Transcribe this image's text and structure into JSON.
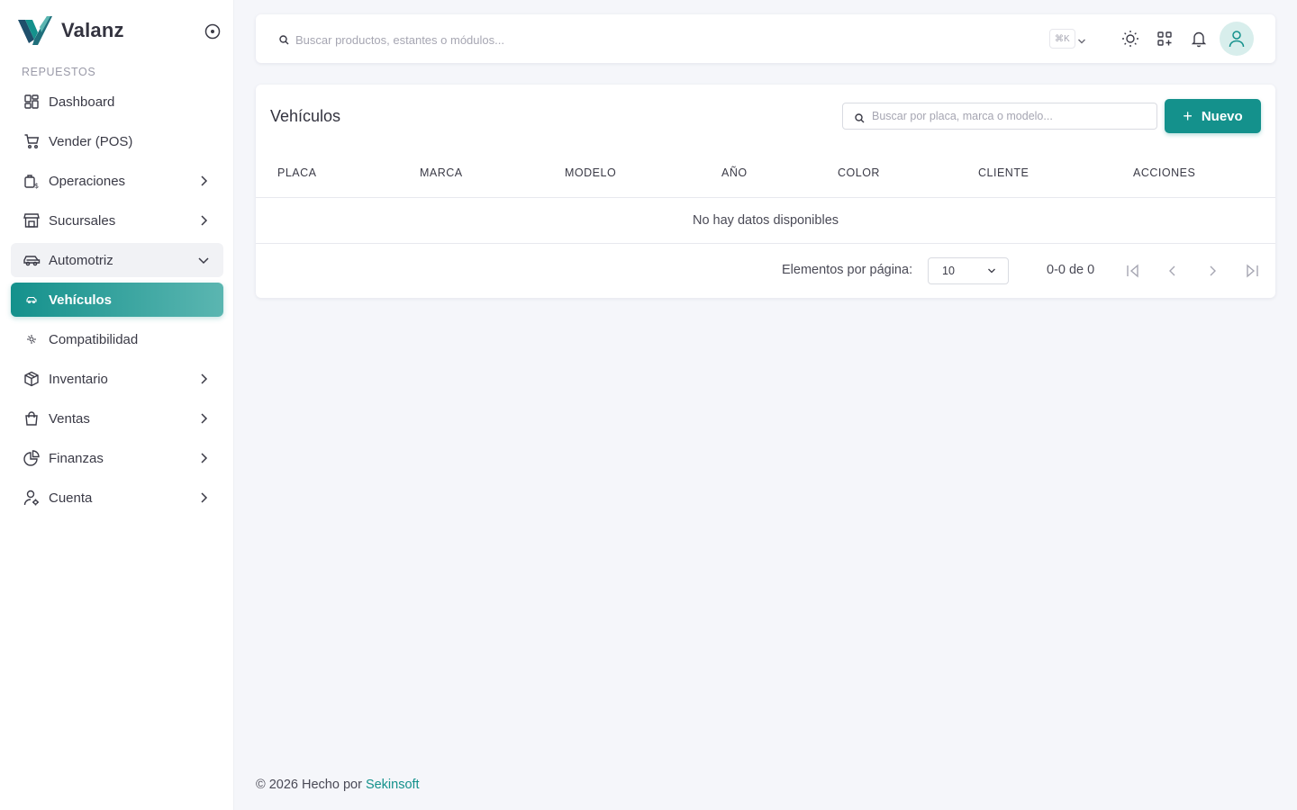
{
  "colors": {
    "accent": "#14918c",
    "accent_light": "#5bb6b1",
    "avatar_bg": "#d8eeec",
    "background": "#f5f6fa"
  },
  "brand": {
    "name": "Valanz",
    "logo_icon": "valanz-logo"
  },
  "sidebar": {
    "section_title": "REPUESTOS",
    "items": [
      {
        "label": "Dashboard",
        "icon": "dashboard-icon",
        "expandable": false
      },
      {
        "label": "Vender (POS)",
        "icon": "cart-icon",
        "expandable": false
      },
      {
        "label": "Operaciones",
        "icon": "operations-icon",
        "expandable": true
      },
      {
        "label": "Sucursales",
        "icon": "store-icon",
        "expandable": true
      },
      {
        "label": "Automotriz",
        "icon": "car-icon",
        "expandable": true,
        "expanded": true
      },
      {
        "label": "Vehículos",
        "icon": "vehicle-icon",
        "active": true
      },
      {
        "label": "Compatibilidad",
        "icon": "compatibility-icon"
      },
      {
        "label": "Inventario",
        "icon": "box-icon",
        "expandable": true
      },
      {
        "label": "Ventas",
        "icon": "bag-icon",
        "expandable": true
      },
      {
        "label": "Finanzas",
        "icon": "pie-chart-icon",
        "expandable": true
      },
      {
        "label": "Cuenta",
        "icon": "user-settings-icon",
        "expandable": true
      }
    ]
  },
  "topbar": {
    "search_placeholder": "Buscar productos, estantes o módulos...",
    "shortcut": "⌘K",
    "icons": [
      "sun-icon",
      "apps-icon",
      "bell-icon",
      "user-icon"
    ]
  },
  "page": {
    "title": "Vehículos",
    "search_placeholder": "Buscar por placa, marca o modelo...",
    "new_button": "Nuevo",
    "columns": [
      "PLACA",
      "MARCA",
      "MODELO",
      "AÑO",
      "COLOR",
      "CLIENTE",
      "ACCIONES"
    ],
    "rows": [],
    "empty_message": "No hay datos disponibles",
    "pagination": {
      "items_per_page_label": "Elementos por página:",
      "items_per_page": "10",
      "range": "0-0 de 0"
    }
  },
  "footer": {
    "text": "© 2026 Hecho por",
    "link": "Sekinsoft"
  }
}
